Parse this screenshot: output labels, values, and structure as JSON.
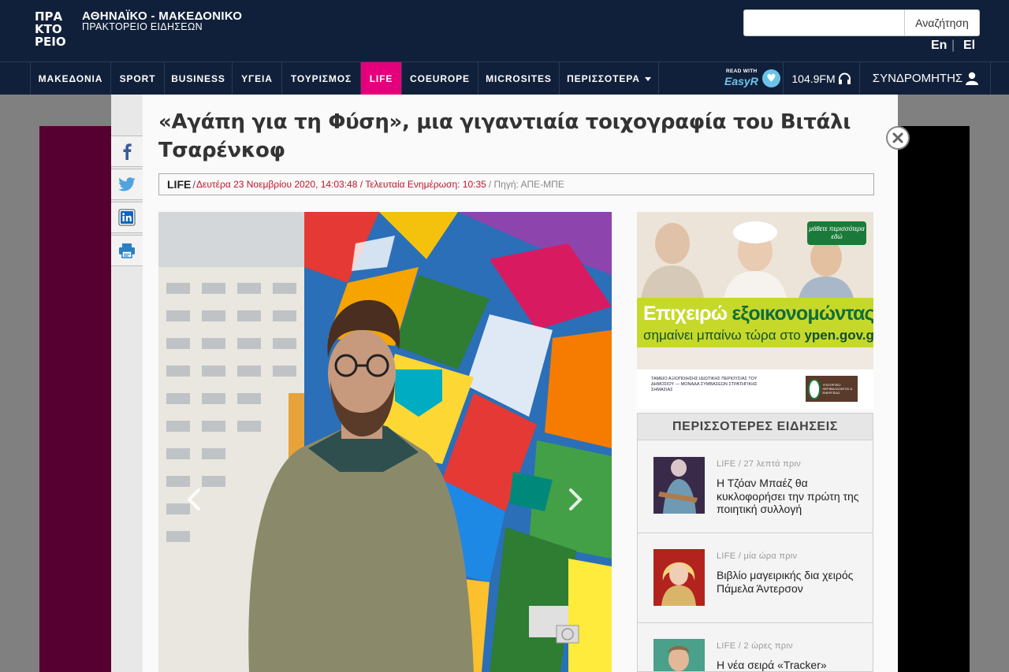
{
  "header": {
    "logo_lines": [
      "ΠΡΑ",
      "ΚΤΟ",
      "ΡΕΙΟ"
    ],
    "agency_name": "ΑΘΗΝΑΪΚΟ - ΜΑΚΕΔΟΝΙΚΟ",
    "agency_sub": "ΠΡΑΚΤΟΡΕΙΟ ΕΙΔΗΣΕΩΝ",
    "search_placeholder": "",
    "search_button": "Αναζήτηση",
    "lang_en": "En",
    "lang_el": "El",
    "lang_sep": "|"
  },
  "nav": {
    "items": [
      {
        "label": "ΜΑΚΕΔΟΝΙΑ"
      },
      {
        "label": "SPORT"
      },
      {
        "label": "BUSINESS"
      },
      {
        "label": "ΥΓΕΙΑ"
      },
      {
        "label": "ΤΟΥΡΙΣΜΟΣ"
      },
      {
        "label": "LIFE"
      },
      {
        "label": "COEUROPE"
      },
      {
        "label": "MICROSITES"
      },
      {
        "label": "ΠΕΡΙΣΣΟΤΕΡΑ"
      }
    ],
    "active_index": 5,
    "readwith_small": "READ WITH",
    "readwith_brand": "EasyR",
    "radio": "104.9FM",
    "subscribers": "ΣΥΝΔΡΟΜΗΤΗΣ"
  },
  "article": {
    "title": "«Αγάπη για τη Φύση», μια γιγαντιαία τοιχογραφία του Βιτάλι Τσαρένκοφ",
    "category": "LIFE",
    "slash": "/",
    "date": "Δευτέρα 23 Νοεμβρίου 2020, 14:03:48 / Τελευταία Ενημέρωση: 10:35",
    "source": "/ Πηγή: ΑΠΕ-ΜΠΕ"
  },
  "ad": {
    "learn_more": "μάθετε περισσότερα εδώ",
    "line1_a": "Επιχειρώ",
    "line1_b": "εξοικονομώντας",
    "line2_a": "σημαίνει μπαίνω τώρα στο",
    "line2_b": "ypen.gov.gr",
    "fund_text": "ΤΑΜΕΙΟ ΑΞΙΟΠΟΙΗΣΗΣ ΙΔΙΩΤΙΚΗΣ ΠΕΡΙΟΥΣΙΑΣ ΤΟΥ ΔΗΜΟΣΙΟΥ — ΜΟΝΑΔΑ ΣΥΜΒΑΣΕΩΝ ΣΤΡΑΤΗΓΙΚΗΣ ΣΗΜΑΣΙΑΣ",
    "ministry_text": "ΥΠΟΥΡΓΕΙΟ ΠΕΡΙΒΑΛΛΟΝΤΟΣ & ΕΝΕΡΓΕΙΑΣ"
  },
  "more_news": {
    "header": "ΠΕΡΙΣΣΟΤΕΡΕΣ ΕΙΔΗΣΕΙΣ",
    "items": [
      {
        "meta": "LIFE / 27 λεπτά πριν",
        "title": "Η Τζόαν Μπαέζ θα κυκλοφορήσει την πρώτη της ποιητική συλλογή"
      },
      {
        "meta": "LIFE / μία ώρα πριν",
        "title": "Βιβλίο μαγειρικής δια χειρός Πάμελα Άντερσον"
      },
      {
        "meta": "LIFE / 2 ώρες πριν",
        "title": "Η νέα σειρά «Tracker»"
      }
    ]
  },
  "colors": {
    "header_bg": "#11203a",
    "life_active": "#e4007c",
    "date_red": "#c0142b",
    "ad_green": "#c6d92a"
  },
  "icons": [
    "facebook-icon",
    "twitter-icon",
    "linkedin-icon",
    "print-icon",
    "close-icon",
    "headphones-icon",
    "user-icon",
    "heart-icon",
    "chevron-left-icon",
    "chevron-right-icon"
  ]
}
